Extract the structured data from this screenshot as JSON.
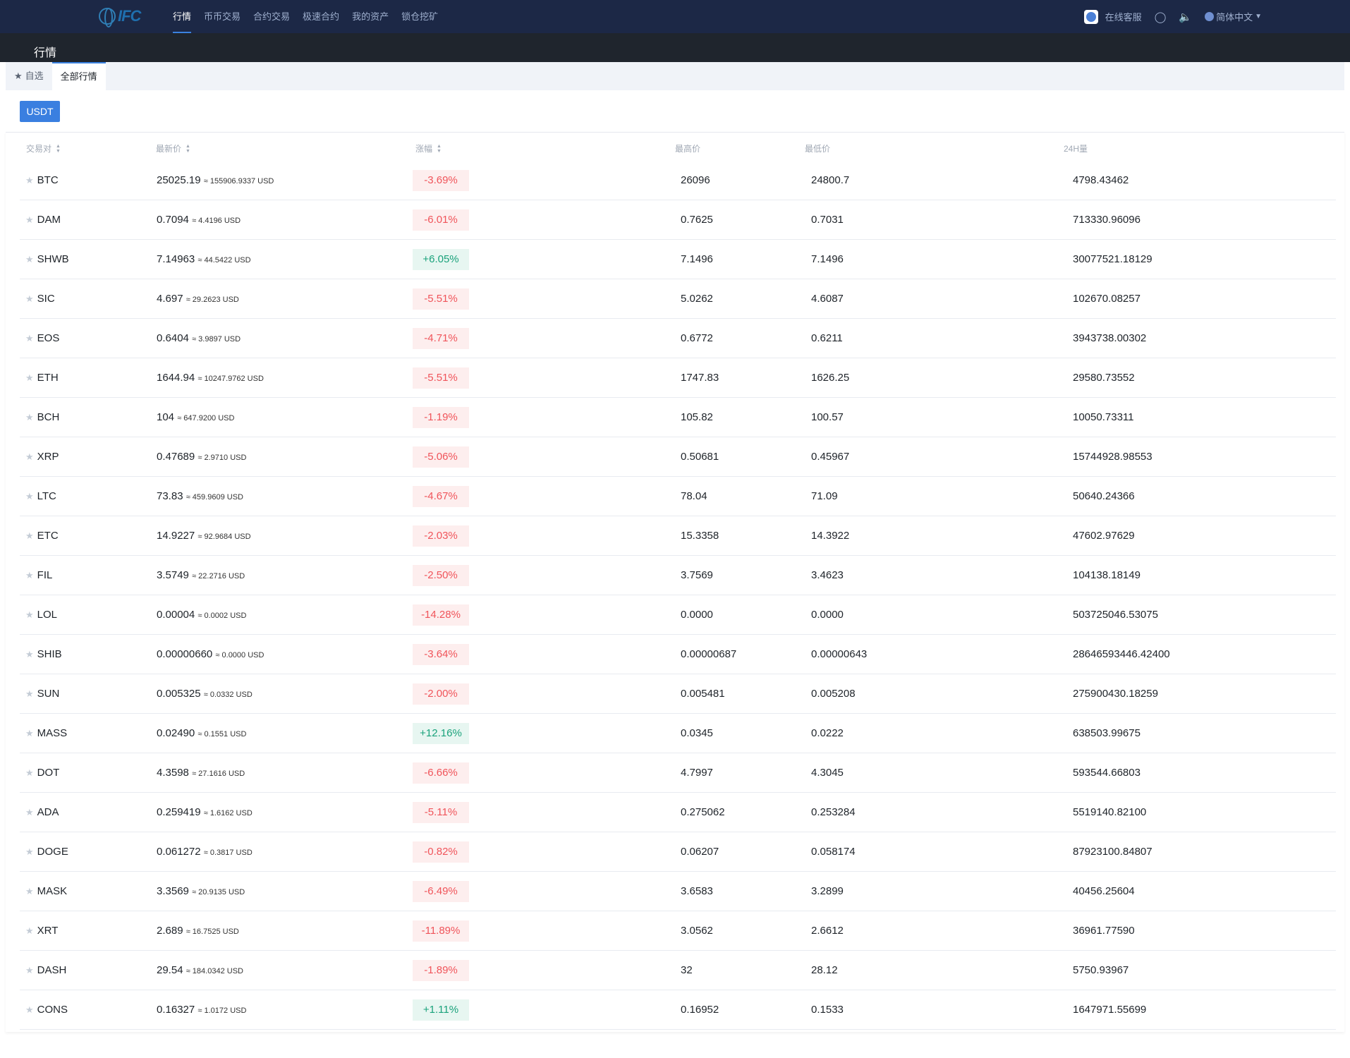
{
  "nav": {
    "logo": "IFC",
    "links": [
      "行情",
      "币币交易",
      "合约交易",
      "极速合约",
      "我的资产",
      "锁仓挖矿"
    ],
    "active": 0,
    "customer_service": "在线客服",
    "language": "简体中文"
  },
  "page_title": "行情",
  "tabs": [
    {
      "label": "自选"
    },
    {
      "label": "全部行情"
    }
  ],
  "quote_button": "USDT",
  "columns": [
    "交易对",
    "最新价",
    "涨幅",
    "最高价",
    "最低价",
    "24H量"
  ],
  "colors": {
    "up": "#1aa27b",
    "down": "#f0545a",
    "accent": "#3a7fe0"
  },
  "rows": [
    {
      "pair": "BTC",
      "price": "25025.19",
      "usd": "≈ 155906.9337 USD",
      "change": "-3.69%",
      "high": "26096",
      "low": "24800.7",
      "vol": "4798.43462"
    },
    {
      "pair": "DAM",
      "price": "0.7094",
      "usd": "≈ 4.4196 USD",
      "change": "-6.01%",
      "high": "0.7625",
      "low": "0.7031",
      "vol": "713330.96096"
    },
    {
      "pair": "SHWB",
      "price": "7.14963",
      "usd": "≈ 44.5422 USD",
      "change": "+6.05%",
      "high": "7.1496",
      "low": "7.1496",
      "vol": "30077521.18129"
    },
    {
      "pair": "SIC",
      "price": "4.697",
      "usd": "≈ 29.2623 USD",
      "change": "-5.51%",
      "high": "5.0262",
      "low": "4.6087",
      "vol": "102670.08257"
    },
    {
      "pair": "EOS",
      "price": "0.6404",
      "usd": "≈ 3.9897 USD",
      "change": "-4.71%",
      "high": "0.6772",
      "low": "0.6211",
      "vol": "3943738.00302"
    },
    {
      "pair": "ETH",
      "price": "1644.94",
      "usd": "≈ 10247.9762 USD",
      "change": "-5.51%",
      "high": "1747.83",
      "low": "1626.25",
      "vol": "29580.73552"
    },
    {
      "pair": "BCH",
      "price": "104",
      "usd": "≈ 647.9200 USD",
      "change": "-1.19%",
      "high": "105.82",
      "low": "100.57",
      "vol": "10050.73311"
    },
    {
      "pair": "XRP",
      "price": "0.47689",
      "usd": "≈ 2.9710 USD",
      "change": "-5.06%",
      "high": "0.50681",
      "low": "0.45967",
      "vol": "15744928.98553"
    },
    {
      "pair": "LTC",
      "price": "73.83",
      "usd": "≈ 459.9609 USD",
      "change": "-4.67%",
      "high": "78.04",
      "low": "71.09",
      "vol": "50640.24366"
    },
    {
      "pair": "ETC",
      "price": "14.9227",
      "usd": "≈ 92.9684 USD",
      "change": "-2.03%",
      "high": "15.3358",
      "low": "14.3922",
      "vol": "47602.97629"
    },
    {
      "pair": "FIL",
      "price": "3.5749",
      "usd": "≈ 22.2716 USD",
      "change": "-2.50%",
      "high": "3.7569",
      "low": "3.4623",
      "vol": "104138.18149"
    },
    {
      "pair": "LOL",
      "price": "0.00004",
      "usd": "≈ 0.0002 USD",
      "change": "-14.28%",
      "high": "0.0000",
      "low": "0.0000",
      "vol": "503725046.53075"
    },
    {
      "pair": "SHIB",
      "price": "0.00000660",
      "usd": "≈ 0.0000 USD",
      "change": "-3.64%",
      "high": "0.00000687",
      "low": "0.00000643",
      "vol": "28646593446.42400"
    },
    {
      "pair": "SUN",
      "price": "0.005325",
      "usd": "≈ 0.0332 USD",
      "change": "-2.00%",
      "high": "0.005481",
      "low": "0.005208",
      "vol": "275900430.18259"
    },
    {
      "pair": "MASS",
      "price": "0.02490",
      "usd": "≈ 0.1551 USD",
      "change": "+12.16%",
      "high": "0.0345",
      "low": "0.0222",
      "vol": "638503.99675"
    },
    {
      "pair": "DOT",
      "price": "4.3598",
      "usd": "≈ 27.1616 USD",
      "change": "-6.66%",
      "high": "4.7997",
      "low": "4.3045",
      "vol": "593544.66803"
    },
    {
      "pair": "ADA",
      "price": "0.259419",
      "usd": "≈ 1.6162 USD",
      "change": "-5.11%",
      "high": "0.275062",
      "low": "0.253284",
      "vol": "5519140.82100"
    },
    {
      "pair": "DOGE",
      "price": "0.061272",
      "usd": "≈ 0.3817 USD",
      "change": "-0.82%",
      "high": "0.06207",
      "low": "0.058174",
      "vol": "87923100.84807"
    },
    {
      "pair": "MASK",
      "price": "3.3569",
      "usd": "≈ 20.9135 USD",
      "change": "-6.49%",
      "high": "3.6583",
      "low": "3.2899",
      "vol": "40456.25604"
    },
    {
      "pair": "XRT",
      "price": "2.689",
      "usd": "≈ 16.7525 USD",
      "change": "-11.89%",
      "high": "3.0562",
      "low": "2.6612",
      "vol": "36961.77590"
    },
    {
      "pair": "DASH",
      "price": "29.54",
      "usd": "≈ 184.0342 USD",
      "change": "-1.89%",
      "high": "32",
      "low": "28.12",
      "vol": "5750.93967"
    },
    {
      "pair": "CONS",
      "price": "0.16327",
      "usd": "≈ 1.0172 USD",
      "change": "+1.11%",
      "high": "0.16952",
      "low": "0.1533",
      "vol": "1647971.55699"
    }
  ]
}
